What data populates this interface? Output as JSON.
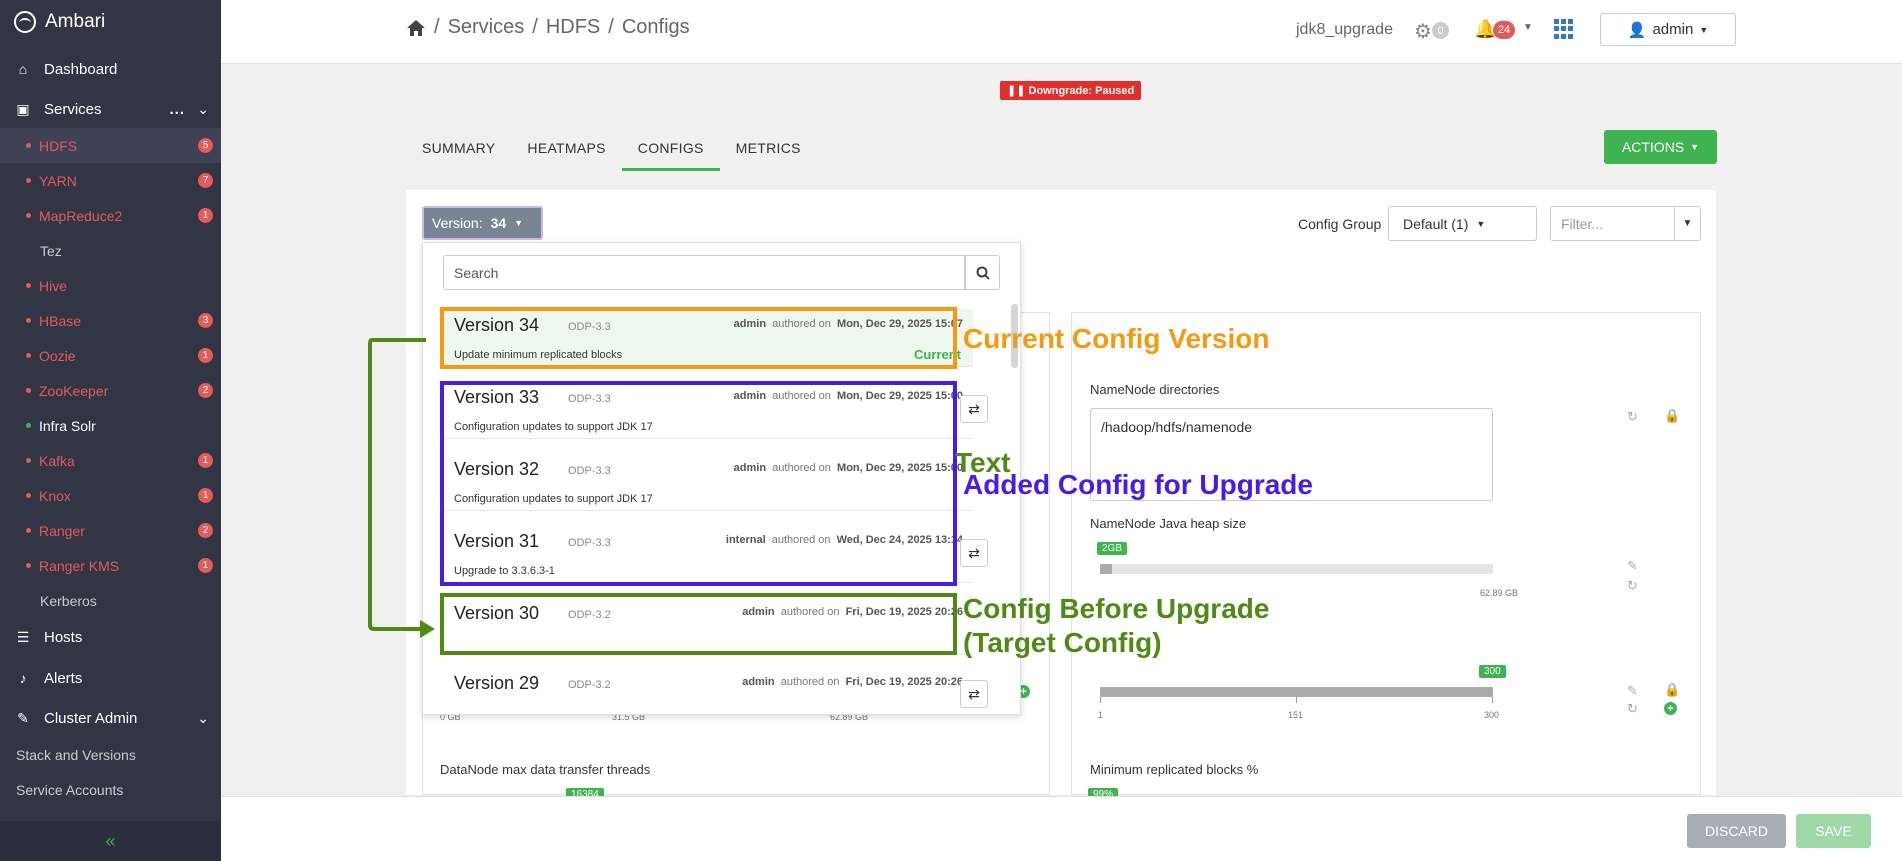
{
  "app": {
    "name": "Ambari"
  },
  "sidebar": {
    "dashboard": "Dashboard",
    "services": "Services",
    "services_dots": "...",
    "services_list": [
      {
        "label": "HDFS",
        "badge": "5"
      },
      {
        "label": "YARN",
        "badge": "7"
      },
      {
        "label": "MapReduce2",
        "badge": "1"
      },
      {
        "label": "Tez",
        "badge": ""
      },
      {
        "label": "Hive",
        "badge": ""
      },
      {
        "label": "HBase",
        "badge": "3"
      },
      {
        "label": "Oozie",
        "badge": "1"
      },
      {
        "label": "ZooKeeper",
        "badge": "2"
      },
      {
        "label": "Infra Solr",
        "badge": ""
      },
      {
        "label": "Kafka",
        "badge": "1"
      },
      {
        "label": "Knox",
        "badge": "1"
      },
      {
        "label": "Ranger",
        "badge": "2"
      },
      {
        "label": "Ranger KMS",
        "badge": "1"
      },
      {
        "label": "Kerberos",
        "badge": ""
      }
    ],
    "hosts": "Hosts",
    "alerts": "Alerts",
    "cluster_admin": "Cluster Admin",
    "stack_versions": "Stack and Versions",
    "service_accounts": "Service Accounts",
    "collapse": "«"
  },
  "topbar": {
    "crumb1": "Services",
    "crumb2": "HDFS",
    "crumb3": "Configs",
    "sep": "/",
    "cluster": "jdk8_upgrade",
    "ops_count": "0",
    "alerts_count": "24",
    "user": "admin"
  },
  "downgrade": "Downgrade: Paused",
  "tabs": [
    "SUMMARY",
    "HEATMAPS",
    "CONFIGS",
    "METRICS"
  ],
  "actions": "ACTIONS",
  "version_btn": {
    "label": "Version:",
    "value": "34"
  },
  "config_group": {
    "label": "Config Group",
    "value": "Default (1)"
  },
  "filter_placeholder": "Filter...",
  "search_placeholder": "Search",
  "versions": [
    {
      "name": "Version 34",
      "stack": "ODP-3.3",
      "author": "admin",
      "authored": "authored on",
      "date": "Mon, Dec 29, 2025 15:07",
      "note": "Update minimum replicated blocks",
      "current": "Current"
    },
    {
      "name": "Version 33",
      "stack": "ODP-3.3",
      "author": "admin",
      "authored": "authored on",
      "date": "Mon, Dec 29, 2025 15:00",
      "note": "Configuration updates to support JDK 17",
      "current": ""
    },
    {
      "name": "Version 32",
      "stack": "ODP-3.3",
      "author": "admin",
      "authored": "authored on",
      "date": "Mon, Dec 29, 2025 15:00",
      "note": "Configuration updates to support JDK 17",
      "current": ""
    },
    {
      "name": "Version 31",
      "stack": "ODP-3.3",
      "author": "internal",
      "authored": "authored on",
      "date": "Wed, Dec 24, 2025 13:14",
      "note": "Upgrade to 3.3.6.3-1",
      "current": ""
    },
    {
      "name": "Version 30",
      "stack": "ODP-3.2",
      "author": "admin",
      "authored": "authored on",
      "date": "Fri, Dec 19, 2025 20:26",
      "note": "",
      "current": ""
    },
    {
      "name": "Version 29",
      "stack": "ODP-3.2",
      "author": "admin",
      "authored": "authored on",
      "date": "Fri, Dec 19, 2025 20:26",
      "note": "",
      "current": ""
    }
  ],
  "settings": {
    "namenode_dirs_label": "NameNode directories",
    "namenode_dirs_value": "/hadoop/hdfs/namenode",
    "heap_label": "NameNode Java heap size",
    "heap_tag": "2GB",
    "heap_max": "62.89 GB",
    "heap_value_fraction": 0.03,
    "repl_tag": "300",
    "repl_ticks": [
      "1",
      "151",
      "300"
    ],
    "left_ticks": [
      "0 GB",
      "31.5 GB",
      "62.89 GB"
    ],
    "datanode_threads_label": "DataNode max data transfer threads",
    "datanode_threads_tag": "16384",
    "min_repl_label": "Minimum replicated blocks %",
    "min_repl_tag": "99%"
  },
  "annotations": {
    "current": "Current Config Version",
    "text": "Text",
    "added": "Added Config for Upgrade",
    "before1": "Config Before Upgrade",
    "before2": "(Target Config)"
  },
  "footer": {
    "discard": "DISCARD",
    "save": "SAVE"
  },
  "colors": {
    "orange": "#f39a12",
    "purple": "#4a1ae6",
    "green": "#4f8a17",
    "brand_green": "#3fb34f",
    "alert_red": "#e35b5b"
  }
}
